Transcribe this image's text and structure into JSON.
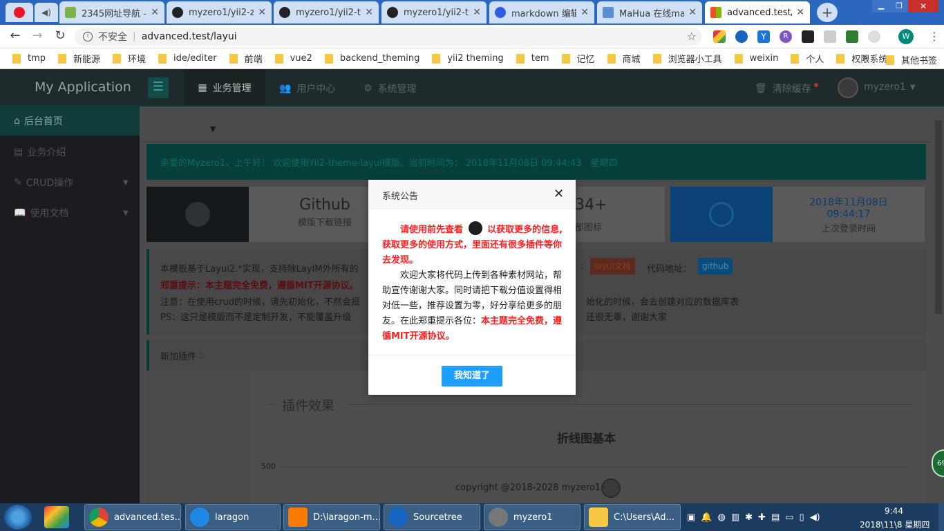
{
  "browser": {
    "tabs": [
      {
        "label": "2345网址导航 - ..."
      },
      {
        "label": "myzero1/yii2-z..."
      },
      {
        "label": "myzero1/yii2-th..."
      },
      {
        "label": "myzero1/yii2-th..."
      },
      {
        "label": "markdown 编辑..."
      },
      {
        "label": "MaHua 在线mar..."
      },
      {
        "label": "advanced.test/l..."
      }
    ],
    "security_label": "不安全",
    "url": "advanced.test/layui",
    "bookmarks": [
      "tmp",
      "新能源",
      "环境",
      "ide/editer",
      "前端",
      "vue2",
      "backend_theming",
      "yii2 theming",
      "tem",
      "记忆",
      "商城",
      "浏览器小工具",
      "weixin",
      "个人",
      "权限系统"
    ],
    "more_bookmarks": "其他书签",
    "extension_avatar": "W"
  },
  "app": {
    "title": "My Application",
    "nav": [
      "业务管理",
      "用户中心",
      "系统管理"
    ],
    "clear_cache": "清除缓存",
    "user": "myzero1",
    "sidebar": [
      "后台首页",
      "业务介绍",
      "CRUD操作",
      "使用文档"
    ],
    "welcome": "亲爱的Myzero1，上午好！ 欢迎使用Yii2-theme-layui模版。当前时间为： 2018年11月08日 09:44:43　星期四",
    "cards": {
      "github_title": "Github",
      "github_sub": "模版下载链接",
      "icons_count": "34+",
      "icons_sub": "部图标",
      "last_login_date": "2018年11月08日",
      "last_login_time": "09:44:17",
      "last_login_label": "上次登录时间"
    },
    "info_line1": "本模板基于Layui2.*实现，支持除LayIM外所有的",
    "doc_label": "layui文档",
    "code_label": "代码地址：",
    "github_badge": "github",
    "warn_title": "郑重提示：本主题完全免费，遵循MIT开源协议。",
    "note_line": "注意：在使用crud的时候，请先初始化，不然会报",
    "note_line_right": "始化的时候，会去创建对应的数据库表",
    "ps_line": "PS：这只是模版而不是定制开发，不能覆盖升级",
    "ps_line_right": "还很无辜，谢谢大家",
    "plugin_title": "新加插件",
    "plugin_effect": "插件效果",
    "chart_title": "折线图基本",
    "chart_tick": "500",
    "copyright": "copyright @2018-2028 myzero1",
    "badge_69": "69"
  },
  "modal": {
    "title": "系统公告",
    "p1_a": "请使用前先查看",
    "p1_b": "以获取更多的信息,获取更多的使用方式，里面还有很多插件等你去发现。",
    "p2": "欢迎大家将代码上传到各种素材网站，帮助宣传谢谢大家。同时请把下载分值设置得相对低一些，推荐设置为零，好分享给更多的朋友。在此郑重提示各位：",
    "p2_red": "本主题完全免费，遵循MIT开源协议。",
    "ok_button": "我知道了"
  },
  "taskbar": {
    "items": [
      "advanced.tes...",
      "laragon",
      "D:\\laragon-m...",
      "Sourcetree",
      "myzero1",
      "C:\\Users\\Ad..."
    ],
    "time": "9:44",
    "date": "2018\\11\\8 星期四"
  },
  "colors": {
    "accent": "#009688",
    "tab_bar": "#2b67bf",
    "button": "#1e9fff",
    "red": "#ff1f1f"
  }
}
